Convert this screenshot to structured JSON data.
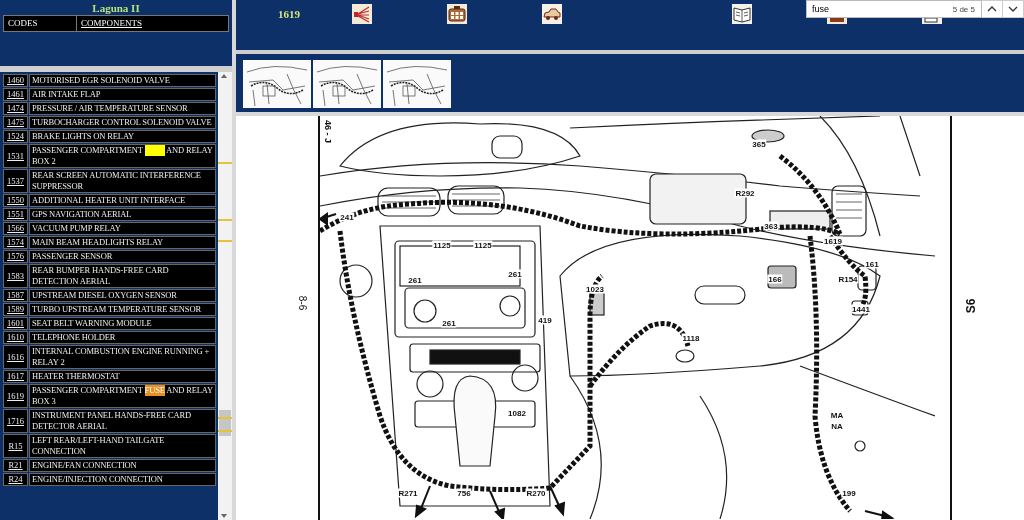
{
  "sidebar": {
    "title": "Laguna II",
    "tabs": [
      {
        "label": "CODES"
      },
      {
        "label": "COMPONENTS"
      }
    ],
    "rows": [
      {
        "code": "1460",
        "description": [
          {
            "text": "MOTORISED EGR SOLENOID VALVE"
          }
        ]
      },
      {
        "code": "1461",
        "description": [
          {
            "text": "AIR INTAKE FLAP"
          }
        ]
      },
      {
        "code": "1474",
        "description": [
          {
            "text": "PRESSURE / AIR TEMPERATURE SENSOR"
          }
        ]
      },
      {
        "code": "1475",
        "description": [
          {
            "text": "TURBOCHARGER CONTROL SOLENOID VALVE"
          }
        ]
      },
      {
        "code": "1524",
        "description": [
          {
            "text": "BRAKE LIGHTS ON RELAY"
          }
        ]
      },
      {
        "code": "1531",
        "description": [
          {
            "text": "PASSENGER COMPARTMENT "
          },
          {
            "match": true,
            "current": false
          },
          {
            "text": " AND RELAY BOX 2"
          }
        ]
      },
      {
        "code": "1537",
        "description": [
          {
            "text": "REAR SCREEN AUTOMATIC INTERFERENCE SUPPRESSOR"
          }
        ]
      },
      {
        "code": "1550",
        "description": [
          {
            "text": "ADDITIONAL HEATER UNIT INTERFACE"
          }
        ]
      },
      {
        "code": "1551",
        "description": [
          {
            "text": "GPS NAVIGATION AERIAL"
          }
        ]
      },
      {
        "code": "1566",
        "description": [
          {
            "text": "VACUUM PUMP RELAY"
          }
        ]
      },
      {
        "code": "1574",
        "description": [
          {
            "text": "MAIN BEAM HEADLIGHTS RELAY"
          }
        ]
      },
      {
        "code": "1576",
        "description": [
          {
            "text": "PASSENGER SENSOR"
          }
        ]
      },
      {
        "code": "1583",
        "description": [
          {
            "text": "REAR BUMPER HANDS-FREE CARD DETECTION AERIAL"
          }
        ]
      },
      {
        "code": "1587",
        "description": [
          {
            "text": "UPSTREAM DIESEL OXYGEN SENSOR"
          }
        ]
      },
      {
        "code": "1589",
        "description": [
          {
            "text": "TURBO UPSTREAM TEMPERATURE SENSOR"
          }
        ]
      },
      {
        "code": "1601",
        "description": [
          {
            "text": "SEAT BELT WARNING MODULE"
          }
        ]
      },
      {
        "code": "1610",
        "description": [
          {
            "text": "TELEPHONE HOLDER"
          }
        ]
      },
      {
        "code": "1616",
        "description": [
          {
            "text": "INTERNAL COMBUSTION ENGINE RUNNING + RELAY 2"
          }
        ]
      },
      {
        "code": "1617",
        "description": [
          {
            "text": "HEATER THERMOSTAT"
          }
        ]
      },
      {
        "code": "1619",
        "description": [
          {
            "text": "PASSENGER COMPARTMENT "
          },
          {
            "text": "FUSE",
            "match": true,
            "current": true
          },
          {
            "text": " AND RELAY BOX 3"
          }
        ]
      },
      {
        "code": "1716",
        "description": [
          {
            "text": "INSTRUMENT PANEL HANDS-FREE CARD DETECTOR AERIAL"
          }
        ]
      },
      {
        "code": "R15",
        "description": [
          {
            "text": "LEFT REAR/LEFT-HAND TAILGATE CONNECTION"
          }
        ]
      },
      {
        "code": "R21",
        "description": [
          {
            "text": "ENGINE/FAN CONNECTION"
          }
        ]
      },
      {
        "code": "R24",
        "description": [
          {
            "text": "ENGINE/INJECTION CONNECTION"
          }
        ]
      }
    ]
  },
  "toolbar": {
    "code": "1619"
  },
  "find_bar": {
    "value": "fuse",
    "count": "5 de 5"
  },
  "document": {
    "corner_label": "46 - J",
    "left_margin_label": "8-6",
    "right_margin_label": "S6",
    "callouts": [
      {
        "label": "365"
      },
      {
        "label": "R292"
      },
      {
        "label": "241"
      },
      {
        "label": "1125"
      },
      {
        "label": "1125"
      },
      {
        "label": "261"
      },
      {
        "label": "261"
      },
      {
        "label": "261"
      },
      {
        "label": "363"
      },
      {
        "label": "1619"
      },
      {
        "label": "161"
      },
      {
        "label": "166"
      },
      {
        "label": "R154"
      },
      {
        "label": "1441"
      },
      {
        "label": "1023"
      },
      {
        "label": "419"
      },
      {
        "label": "1118"
      },
      {
        "label": "1082"
      },
      {
        "label": "MA"
      },
      {
        "label": "NA"
      },
      {
        "label": "R271"
      },
      {
        "label": "756"
      },
      {
        "label": "R270"
      },
      {
        "label": "199"
      }
    ]
  }
}
